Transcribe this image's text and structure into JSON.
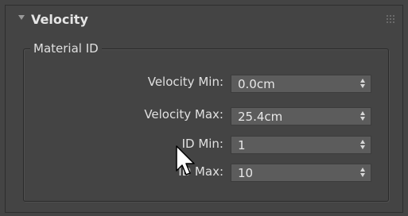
{
  "rollout": {
    "title": "Velocity",
    "collapse_icon": "triangle-down-icon",
    "grip_icon": "grip-dots-icon"
  },
  "group": {
    "title": "Material ID"
  },
  "fields": [
    {
      "label": "Velocity Min:",
      "value": "0.0cm"
    },
    {
      "label": "Velocity Max:",
      "value": "25.4cm"
    },
    {
      "label": "ID Min:",
      "value": "1"
    },
    {
      "label": "ID Max:",
      "value": "10"
    }
  ],
  "cursor": {
    "icon": "mouse-pointer-icon"
  },
  "colors": {
    "panel_bg": "#444444",
    "spinner_bg": "#5c5c5c",
    "text": "#e0e0e0"
  }
}
